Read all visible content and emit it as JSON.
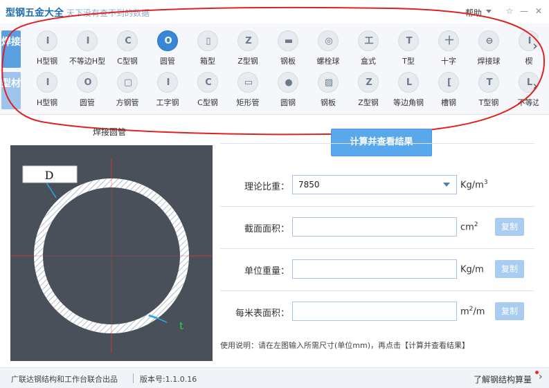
{
  "app": {
    "title": "型钢五金大全",
    "slogan": "天下没有查不到的数据",
    "help_label": "帮助"
  },
  "window_controls": {
    "pin": "☆",
    "minimize": "—",
    "close": "✕"
  },
  "tabs": [
    {
      "label": "焊接"
    },
    {
      "label": "型材"
    }
  ],
  "row_welded": [
    {
      "label": "H型钢",
      "glyph": "I"
    },
    {
      "label": "不等边H型",
      "glyph": "I"
    },
    {
      "label": "C型钢",
      "glyph": "C"
    },
    {
      "label": "圆管",
      "glyph": "O"
    },
    {
      "label": "箱型",
      "glyph": "▯"
    },
    {
      "label": "Z型钢",
      "glyph": "Z"
    },
    {
      "label": "钢板",
      "glyph": "▬"
    },
    {
      "label": "螺栓球",
      "glyph": "◎"
    },
    {
      "label": "盒式",
      "glyph": "工"
    },
    {
      "label": "T型",
      "glyph": "T"
    },
    {
      "label": "十字",
      "glyph": "十"
    },
    {
      "label": "焊接球",
      "glyph": "⊖"
    },
    {
      "label": "楔",
      "glyph": "I"
    }
  ],
  "row_profile": [
    {
      "label": "H型钢",
      "glyph": "I"
    },
    {
      "label": "圆管",
      "glyph": "O"
    },
    {
      "label": "方钢管",
      "glyph": "▢"
    },
    {
      "label": "工字钢",
      "glyph": "I"
    },
    {
      "label": "C型钢",
      "glyph": "C"
    },
    {
      "label": "矩形管",
      "glyph": "▭"
    },
    {
      "label": "圆钢",
      "glyph": "●"
    },
    {
      "label": "钢板",
      "glyph": "▨"
    },
    {
      "label": "Z型钢",
      "glyph": "Z"
    },
    {
      "label": "等边角钢",
      "glyph": "L"
    },
    {
      "label": "槽钢",
      "glyph": "["
    },
    {
      "label": "T型钢",
      "glyph": "T"
    },
    {
      "label": "不等边",
      "glyph": "L"
    }
  ],
  "section": {
    "title": "焊接圆管",
    "dim_d": "D",
    "dim_t": "t"
  },
  "calc_button": "计算并查看结果",
  "fields": [
    {
      "label": "理论比重：",
      "value": "7850",
      "unit": "Kg/m",
      "sup": "3",
      "copy": ""
    },
    {
      "label": "截面面积：",
      "value": "",
      "unit": "cm",
      "sup": "2",
      "copy": "复制"
    },
    {
      "label": "单位重量：",
      "value": "",
      "unit": "Kg/m",
      "sup": "",
      "copy": "复制"
    },
    {
      "label": "每米表面积：",
      "value": "",
      "unit": "m",
      "sup": "2",
      "unit_suffix": "/m",
      "copy": "复制"
    }
  ],
  "usage": "使用说明：请在左图输入所需尺寸(单位mm)，再点击【计算并查看结果】",
  "footer": {
    "left": "广联达钢结构和工作台联合出品",
    "version": "版本号:1.1.0.16",
    "right": "了解钢结构算量"
  },
  "colors": {
    "accent": "#3a86d6",
    "button": "#5aa8ec",
    "annotation": "#e02020",
    "diagram_bg": "#4a5059"
  }
}
